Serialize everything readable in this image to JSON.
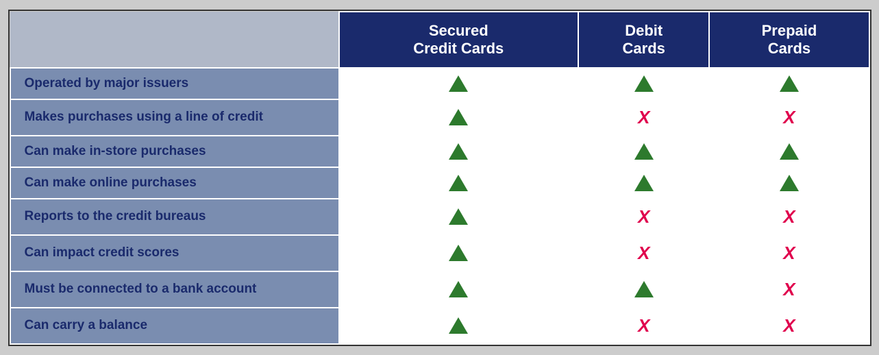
{
  "header": {
    "col1_label": "",
    "col2_line1": "Secured",
    "col2_line2": "Credit Cards",
    "col3_line1": "Debit",
    "col3_line2": "Cards",
    "col4_line1": "Prepaid",
    "col4_line2": "Cards"
  },
  "rows": [
    {
      "label": "Operated by major issuers",
      "secured": "check",
      "debit": "check",
      "prepaid": "check"
    },
    {
      "label": "Makes purchases using a line of credit",
      "secured": "check",
      "debit": "cross",
      "prepaid": "cross"
    },
    {
      "label": "Can make in-store purchases",
      "secured": "check",
      "debit": "check",
      "prepaid": "check"
    },
    {
      "label": "Can make online purchases",
      "secured": "check",
      "debit": "check",
      "prepaid": "check"
    },
    {
      "label": "Reports to the credit bureaus",
      "secured": "check",
      "debit": "cross",
      "prepaid": "cross"
    },
    {
      "label": "Can impact credit scores",
      "secured": "check",
      "debit": "cross",
      "prepaid": "cross"
    },
    {
      "label": "Must be connected to a bank account",
      "secured": "check",
      "debit": "check",
      "prepaid": "cross"
    },
    {
      "label": "Can carry a balance",
      "secured": "check",
      "debit": "cross",
      "prepaid": "cross"
    }
  ],
  "colors": {
    "header_bg": "#1a2a6c",
    "header_text": "#ffffff",
    "row_label_bg": "#7a8db0",
    "row_label_text": "#1a2a6c",
    "check_color": "#2d7a2d",
    "cross_color": "#e0004d"
  }
}
